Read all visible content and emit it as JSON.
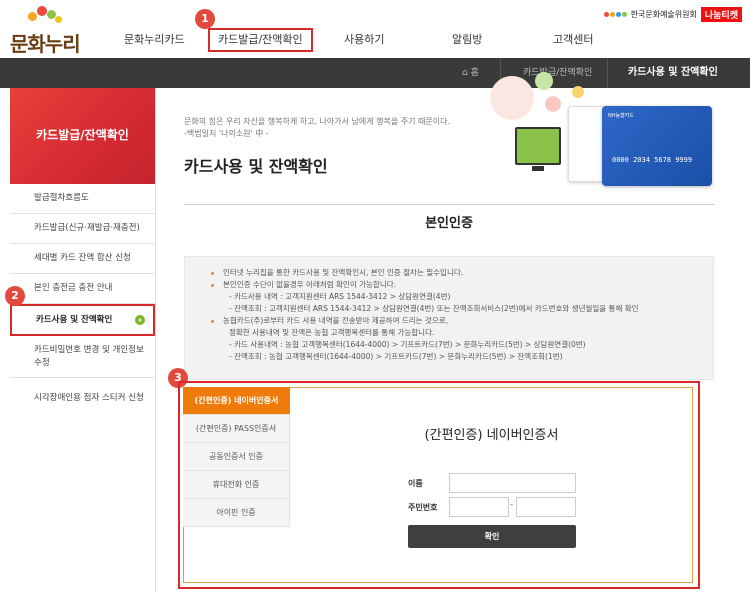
{
  "header": {
    "logo_text": "문화누리",
    "nav": [
      "문화누리카드",
      "카드발급/잔액확인",
      "사용하기",
      "알림방",
      "고객센터"
    ],
    "org_name": "한국문화예술위원회",
    "nanum_label": "나눔티켓"
  },
  "badges": [
    "1",
    "2",
    "3"
  ],
  "breadcrumb": {
    "home": "홈",
    "parent": "카드발급/잔액확인",
    "current": "카드사용 및 잔액확인"
  },
  "sidebar": {
    "title": "카드발급/잔액확인",
    "items": [
      "발급절차흐름도",
      "카드발급(신규·재발급·재충전)",
      "세대별 카드 잔액 합산 신청",
      "본인 충전금 충전 안내",
      "카드사용 및 잔액확인",
      "카드비밀번호 변경 및 개인정보수정",
      "시각장애인용 점자 스티커 신청"
    ],
    "active_index": 4
  },
  "main": {
    "quote_line1": "문화의 힘은 우리 자신을 행복하게 하고, 나아가서 남에게 행복을 주기 때문이다.",
    "quote_line2": "-백범일지 '나의소원' 中 -",
    "title": "카드사용 및 잔액확인",
    "card_number": "0000 2034 5678 9999",
    "card_brand": "NH농협카드",
    "section_title": "본인인증",
    "info_lines": [
      {
        "text": "인터넷 누리집을 통한 카드사용 및 잔액확인시, 본인 인증 절차는 필수입니다.",
        "bullet": true
      },
      {
        "text": "본인인증 수단이 없을경우 아래처럼 확인이 가능합니다.",
        "bullet": true
      },
      {
        "text": "- 카드사용 내역 : 고객지원센터 ARS 1544-3412 > 상담원연결(4번)",
        "bullet": false
      },
      {
        "text": "- 잔액조회 : 고객지원센터 ARS 1544-3412 > 상담원연결(4번) 또는 잔액조회서비스(2번)에서 카드번호와 생년월일을 통해 확인",
        "bullet": false
      },
      {
        "text": "농협카드(주)로부터 카드 사용 내역을 전송받아 제공하여 드리는 것으로,",
        "bullet": true
      },
      {
        "text": "정확한 사용내역 및 잔액은 농협 고객행복센터를 통해 가능합니다.",
        "bullet": false
      },
      {
        "text": "- 카드 사용내역 : 농협 고객행복센터(1644-4000) > 기프트카드(7번) > 문화누리카드(5번) > 상담원연결(0번)",
        "bullet": false
      },
      {
        "text": "- 잔액조회 : 농협 고객행복센터(1644-4000) > 기프트카드(7번) > 문화누리카드(5번) > 잔액조회(1번)",
        "bullet": false
      }
    ]
  },
  "auth": {
    "tabs": [
      "(간편인증) 네이버인증서",
      "(간편인증) PASS인증서",
      "공동인증서 인증",
      "휴대전화 인증",
      "아이핀 인증"
    ],
    "active_tab": 0,
    "title": "(간편인증) 네이버인증서",
    "name_label": "이름",
    "ssn_label": "주민번호",
    "dash": "-",
    "confirm_label": "확인"
  },
  "colors": {
    "brand_red": "#d62a2a",
    "tab_orange": "#ee7b0a",
    "dark_bar": "#3a3a3a"
  }
}
